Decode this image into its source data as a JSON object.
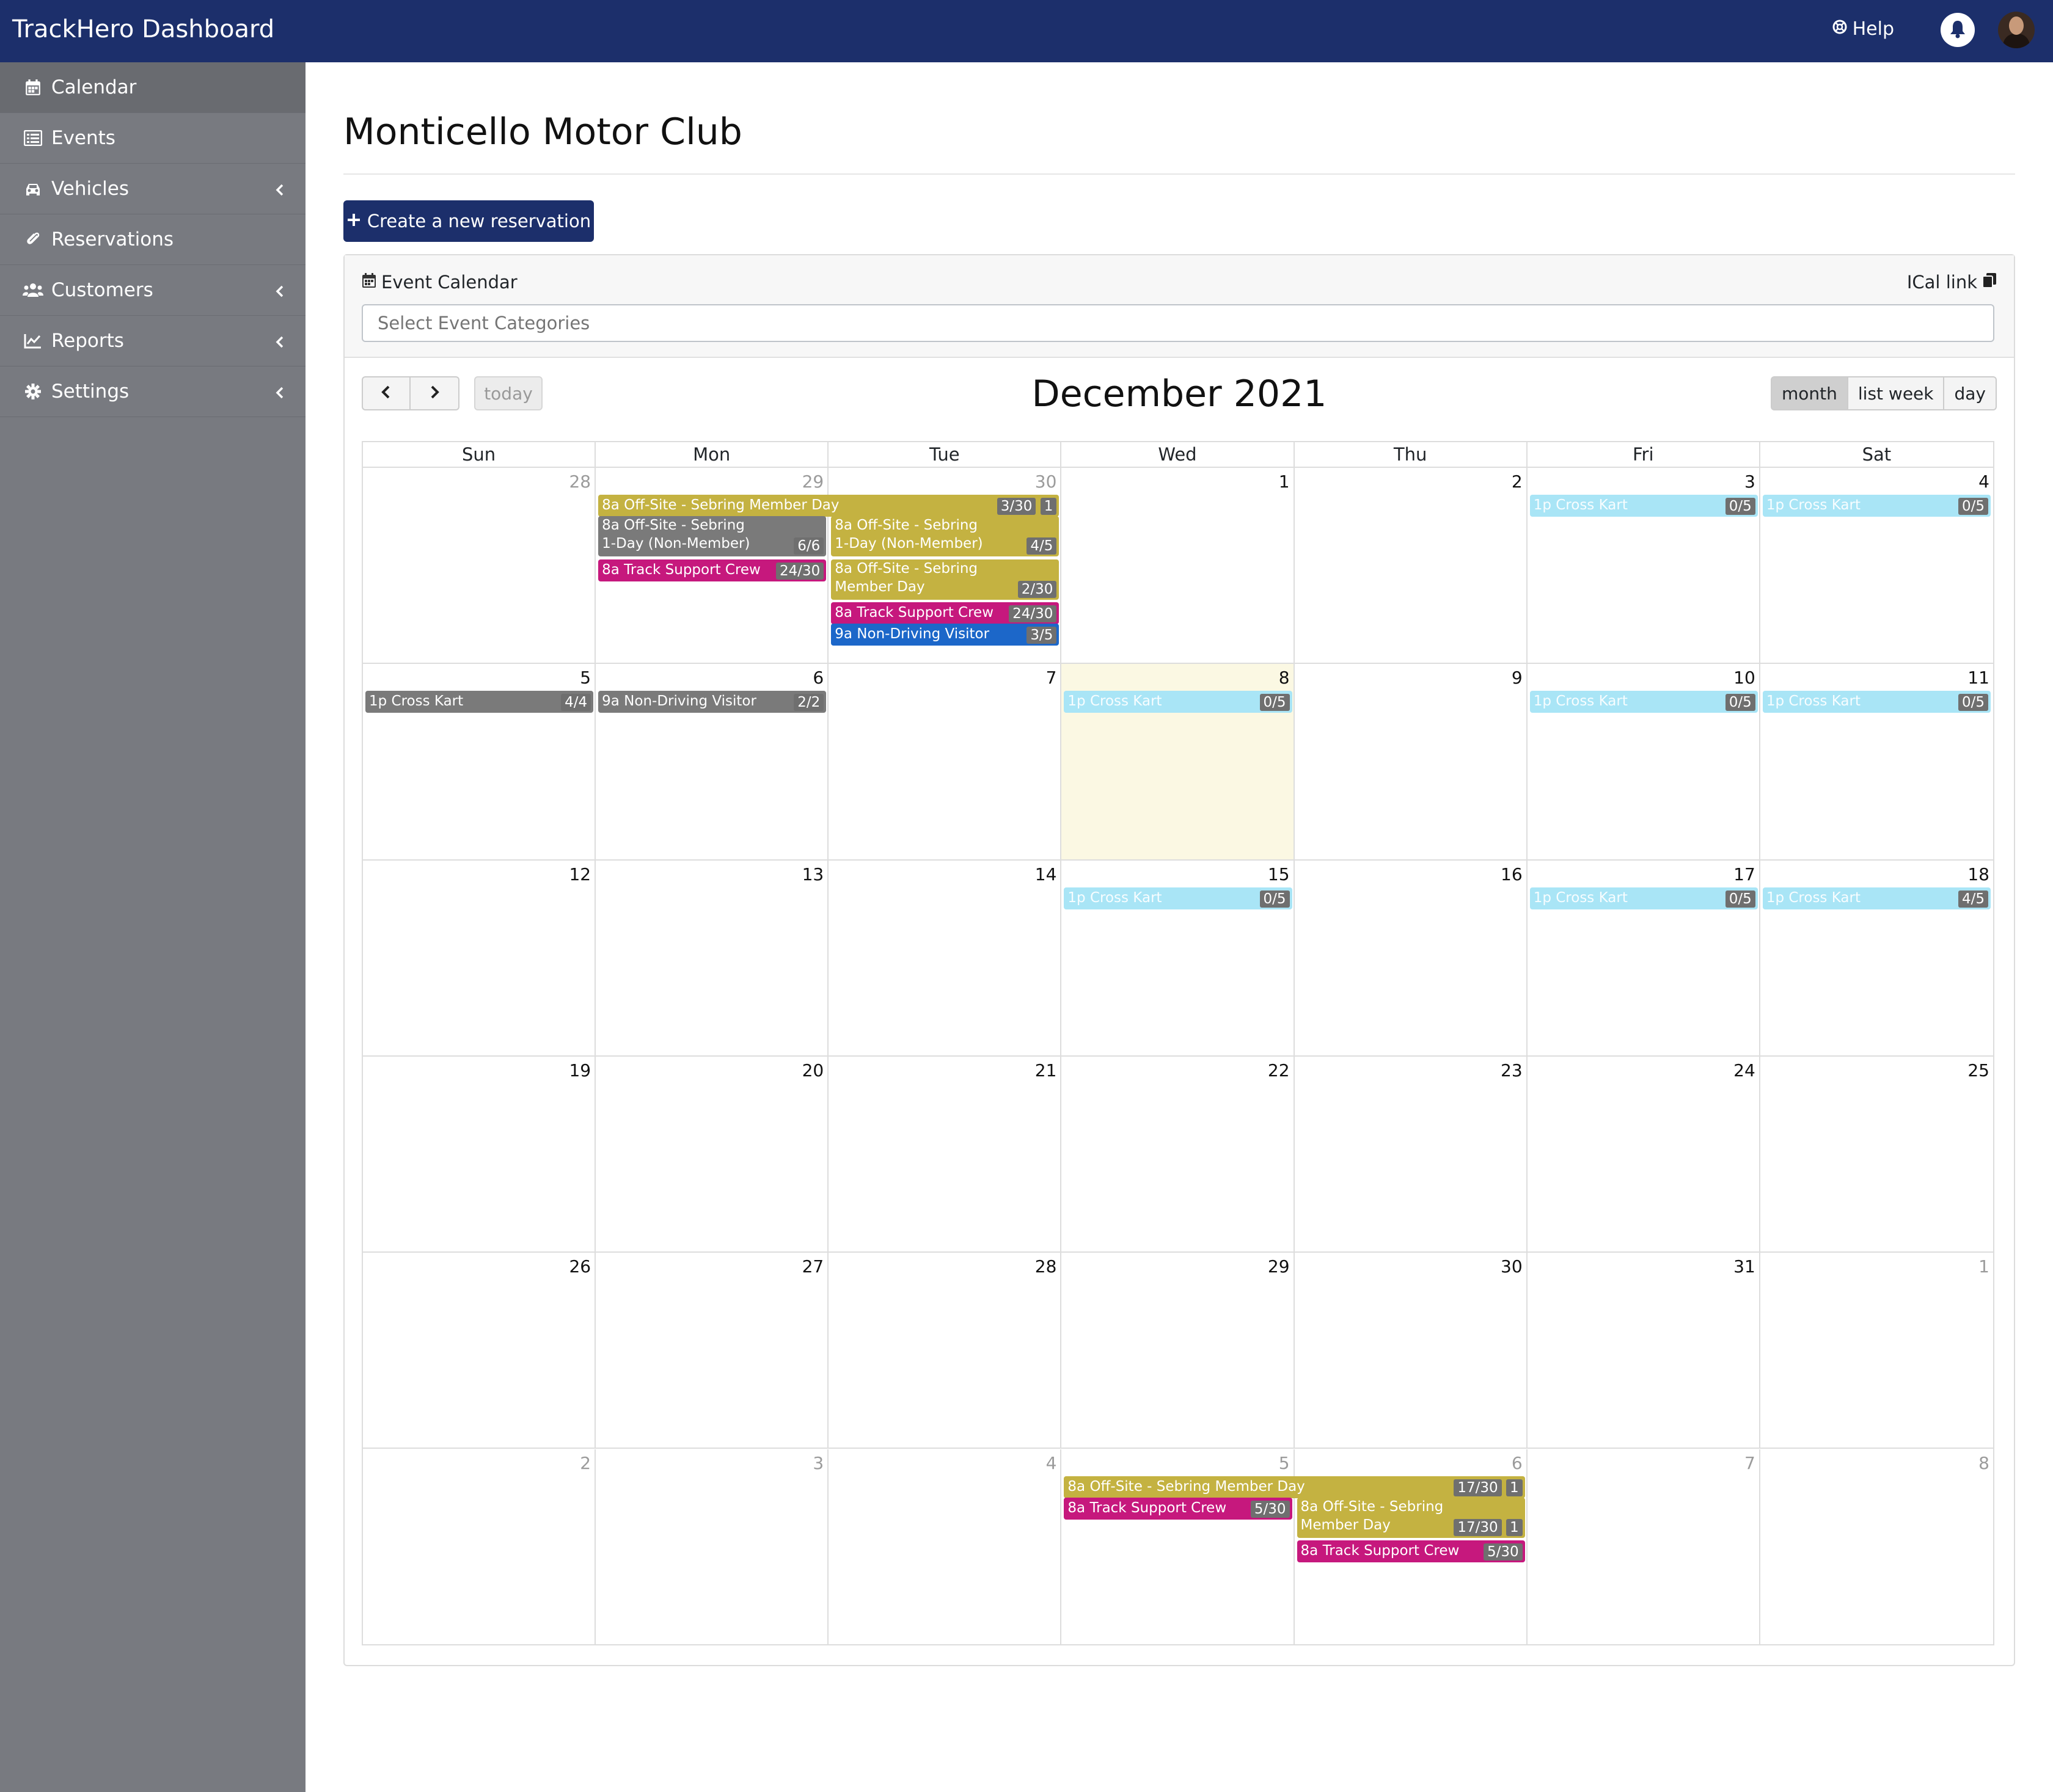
{
  "app": {
    "title": "TrackHero Dashboard",
    "help": "Help"
  },
  "sidebar": {
    "items": [
      {
        "label": "Calendar",
        "icon": "calendar-icon",
        "active": true,
        "chevron": false
      },
      {
        "label": "Events",
        "icon": "list-icon",
        "active": false,
        "chevron": false
      },
      {
        "label": "Vehicles",
        "icon": "car-icon",
        "active": false,
        "chevron": true
      },
      {
        "label": "Reservations",
        "icon": "paperclip-icon",
        "active": false,
        "chevron": false
      },
      {
        "label": "Customers",
        "icon": "users-icon",
        "active": false,
        "chevron": true
      },
      {
        "label": "Reports",
        "icon": "chart-icon",
        "active": false,
        "chevron": true
      },
      {
        "label": "Settings",
        "icon": "gear-icon",
        "active": false,
        "chevron": true
      }
    ]
  },
  "page": {
    "title": "Monticello Motor Club",
    "create_button": "Create a new reservation"
  },
  "calendar_card": {
    "title": "Event Calendar",
    "ical_link": "ICal link",
    "categories_placeholder": "Select Event Categories"
  },
  "calendar": {
    "title": "December 2021",
    "today_label": "today",
    "views": [
      "month",
      "list week",
      "day"
    ],
    "active_view": "month",
    "weekdays": [
      "Sun",
      "Mon",
      "Tue",
      "Wed",
      "Thu",
      "Fri",
      "Sat"
    ],
    "weeks": [
      [
        {
          "d": "28",
          "m": true
        },
        {
          "d": "29",
          "m": true
        },
        {
          "d": "30",
          "m": true
        },
        {
          "d": "1"
        },
        {
          "d": "2"
        },
        {
          "d": "3"
        },
        {
          "d": "4"
        }
      ],
      [
        {
          "d": "5"
        },
        {
          "d": "6"
        },
        {
          "d": "7"
        },
        {
          "d": "8",
          "today": true
        },
        {
          "d": "9"
        },
        {
          "d": "10"
        },
        {
          "d": "11"
        }
      ],
      [
        {
          "d": "12"
        },
        {
          "d": "13"
        },
        {
          "d": "14"
        },
        {
          "d": "15"
        },
        {
          "d": "16"
        },
        {
          "d": "17"
        },
        {
          "d": "18"
        }
      ],
      [
        {
          "d": "19"
        },
        {
          "d": "20"
        },
        {
          "d": "21"
        },
        {
          "d": "22"
        },
        {
          "d": "23"
        },
        {
          "d": "24"
        },
        {
          "d": "25"
        }
      ],
      [
        {
          "d": "26"
        },
        {
          "d": "27"
        },
        {
          "d": "28"
        },
        {
          "d": "29"
        },
        {
          "d": "30"
        },
        {
          "d": "31"
        },
        {
          "d": "1",
          "m": true
        }
      ],
      [
        {
          "d": "2",
          "m": true
        },
        {
          "d": "3",
          "m": true
        },
        {
          "d": "4",
          "m": true
        },
        {
          "d": "5",
          "m": true
        },
        {
          "d": "6",
          "m": true
        },
        {
          "d": "7",
          "m": true
        },
        {
          "d": "8",
          "m": true
        }
      ]
    ],
    "events": [
      {
        "week": 0,
        "day": 1,
        "span": 2,
        "slot": 0,
        "text": "8a Off-Site - Sebring Member Day",
        "count": "3/30",
        "extra": "1",
        "color": "olive"
      },
      {
        "week": 0,
        "day": 1,
        "span": 1,
        "slot": 1,
        "text": "8a Off-Site - Sebring 1-Day (Non-Member)",
        "count": "6/6",
        "color": "gray",
        "tall": true
      },
      {
        "week": 0,
        "day": 1,
        "span": 1,
        "slot": 3,
        "text": "8a Track Support Crew",
        "count": "24/30",
        "color": "pink"
      },
      {
        "week": 0,
        "day": 2,
        "span": 1,
        "slot": 1,
        "text": "8a Off-Site - Sebring 1-Day (Non-Member)",
        "count": "4/5",
        "color": "olive",
        "tall": true
      },
      {
        "week": 0,
        "day": 2,
        "span": 1,
        "slot": 3,
        "text": "8a Off-Site - Sebring Member Day",
        "count": "2/30",
        "color": "olive",
        "tall": true
      },
      {
        "week": 0,
        "day": 2,
        "span": 1,
        "slot": 5,
        "text": "8a Track Support Crew",
        "count": "24/30",
        "color": "pink"
      },
      {
        "week": 0,
        "day": 2,
        "span": 1,
        "slot": 6,
        "text": "9a Non-Driving Visitor",
        "count": "3/5",
        "color": "blue"
      },
      {
        "week": 0,
        "day": 5,
        "span": 1,
        "slot": 0,
        "text": "1p Cross Kart",
        "count": "0/5",
        "color": "cyan"
      },
      {
        "week": 0,
        "day": 6,
        "span": 1,
        "slot": 0,
        "text": "1p Cross Kart",
        "count": "0/5",
        "color": "cyan"
      },
      {
        "week": 1,
        "day": 0,
        "span": 1,
        "slot": 0,
        "text": "1p Cross Kart",
        "count": "4/4",
        "color": "gray"
      },
      {
        "week": 1,
        "day": 1,
        "span": 1,
        "slot": 0,
        "text": "9a Non-Driving Visitor",
        "count": "2/2",
        "color": "gray"
      },
      {
        "week": 1,
        "day": 3,
        "span": 1,
        "slot": 0,
        "text": "1p Cross Kart",
        "count": "0/5",
        "color": "cyan"
      },
      {
        "week": 1,
        "day": 5,
        "span": 1,
        "slot": 0,
        "text": "1p Cross Kart",
        "count": "0/5",
        "color": "cyan"
      },
      {
        "week": 1,
        "day": 6,
        "span": 1,
        "slot": 0,
        "text": "1p Cross Kart",
        "count": "0/5",
        "color": "cyan"
      },
      {
        "week": 2,
        "day": 3,
        "span": 1,
        "slot": 0,
        "text": "1p Cross Kart",
        "count": "0/5",
        "color": "cyan"
      },
      {
        "week": 2,
        "day": 5,
        "span": 1,
        "slot": 0,
        "text": "1p Cross Kart",
        "count": "0/5",
        "color": "cyan"
      },
      {
        "week": 2,
        "day": 6,
        "span": 1,
        "slot": 0,
        "text": "1p Cross Kart",
        "count": "4/5",
        "color": "cyan"
      },
      {
        "week": 5,
        "day": 3,
        "span": 2,
        "slot": 0,
        "text": "8a Off-Site - Sebring Member Day",
        "count": "17/30",
        "extra": "1",
        "color": "olive"
      },
      {
        "week": 5,
        "day": 3,
        "span": 1,
        "slot": 1,
        "text": "8a Track Support Crew",
        "count": "5/30",
        "color": "pink"
      },
      {
        "week": 5,
        "day": 4,
        "span": 1,
        "slot": 1,
        "text": "8a Off-Site - Sebring Member Day",
        "count": "17/30",
        "extra": "1",
        "color": "olive",
        "tall": true
      },
      {
        "week": 5,
        "day": 4,
        "span": 1,
        "slot": 3,
        "text": "8a Track Support Crew",
        "count": "5/30",
        "color": "pink"
      }
    ]
  }
}
